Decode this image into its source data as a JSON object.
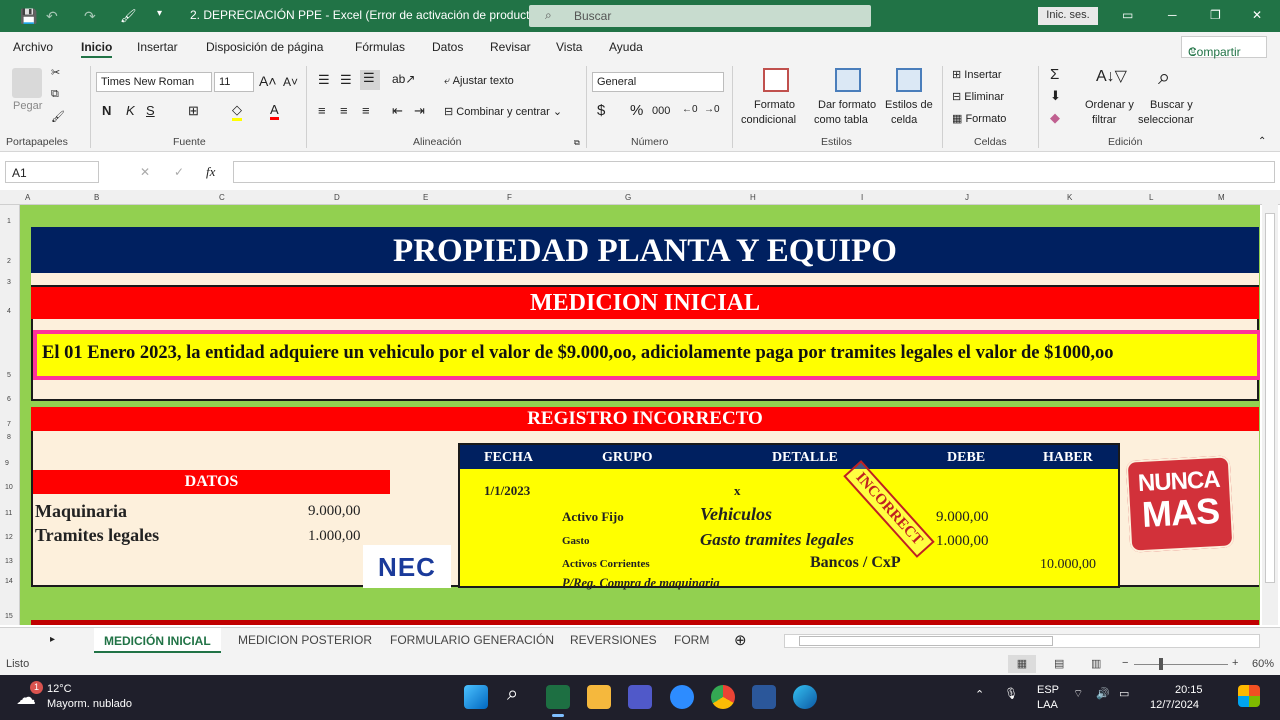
{
  "window": {
    "title": "2. DEPRECIACIÓN PPE  -  Excel (Error de activación de productos)",
    "search": "Buscar",
    "signin": "Inic. ses."
  },
  "menu": {
    "items": [
      "Archivo",
      "Inicio",
      "Insertar",
      "Disposición de página",
      "Fórmulas",
      "Datos",
      "Revisar",
      "Vista",
      "Ayuda"
    ],
    "share": "Compartir",
    "active": "Inicio"
  },
  "ribbon": {
    "paste": "Pegar",
    "font_name": "Times New Roman",
    "font_size": "11",
    "wrap": "Ajustar texto",
    "merge": "Combinar y centrar",
    "number_format": "General",
    "cond_format": [
      "Formato",
      "condicional"
    ],
    "format_table": [
      "Dar formato",
      "como tabla"
    ],
    "cell_styles": [
      "Estilos de",
      "celda"
    ],
    "insert": "Insertar",
    "delete": "Eliminar",
    "format": "Formato",
    "sort": [
      "Ordenar y",
      "filtrar"
    ],
    "find": [
      "Buscar y",
      "seleccionar"
    ],
    "groups": [
      "Portapapeles",
      "Fuente",
      "Alineación",
      "Número",
      "Estilos",
      "Celdas",
      "Edición"
    ]
  },
  "formula_bar": {
    "name_box": "A1",
    "fx": "fx",
    "content": ""
  },
  "columns": [
    "A",
    "B",
    "C",
    "D",
    "E",
    "F",
    "G",
    "H",
    "I",
    "J",
    "K",
    "L",
    "M"
  ],
  "rows": [
    "1",
    "2",
    "3",
    "4",
    "5",
    "6",
    "7",
    "8",
    "9",
    "10",
    "11",
    "12",
    "13",
    "14",
    "15"
  ],
  "sheet": {
    "title": "PROPIEDAD PLANTA Y EQUIPO",
    "section1": "MEDICION INICIAL",
    "statement": "El 01 Enero 2023,  la entidad adquiere un vehiculo por el valor de $9.000,oo, adiciolamente paga por tramites legales el valor de $1000,oo",
    "section2": "REGISTRO INCORRECTO",
    "datos": {
      "header": "DATOS",
      "rows": [
        {
          "label": "Maquinaria",
          "value": "9.000,00"
        },
        {
          "label": "Tramites legales",
          "value": "1.000,00"
        }
      ]
    },
    "logo_nec": "NEC",
    "table": {
      "headers": [
        "FECHA",
        "GRUPO",
        "DETALLE",
        "DEBE",
        "HABER"
      ],
      "date": "1/1/2023",
      "x": "x",
      "grupo": [
        "Activo Fijo",
        "Gasto",
        "Activos Corrientes"
      ],
      "detalle": [
        "Vehiculos",
        "Gasto tramites legales",
        "Bancos / CxP"
      ],
      "debe": [
        "9.000,00",
        "1.000,00"
      ],
      "haber": "10.000,00",
      "note": "P/Reg. Compra de maquinaria",
      "stamp": "INCORRECT"
    },
    "nunca": [
      "NUNCA",
      "MAS"
    ]
  },
  "tabs": {
    "items": [
      "MEDICIÓN INICIAL",
      "MEDICION POSTERIOR",
      "FORMULARIO GENERACIÓN",
      "REVERSIONES",
      "FORM"
    ],
    "active": "MEDICIÓN INICIAL"
  },
  "status": {
    "ready": "Listo",
    "zoom": "60%"
  },
  "taskbar": {
    "temp": "12°C",
    "weather": "Mayorm. nublado",
    "badge": "1",
    "lang1": "ESP",
    "lang2": "LAA",
    "time": "20:15",
    "date": "12/7/2024"
  },
  "colors": {
    "excel_green": "#217346",
    "sheet_green": "#92d050",
    "navy": "#002060",
    "red": "#ff0000",
    "yellow": "#ffff00",
    "pink": "#ff3399",
    "cream": "#fdf0dc"
  }
}
